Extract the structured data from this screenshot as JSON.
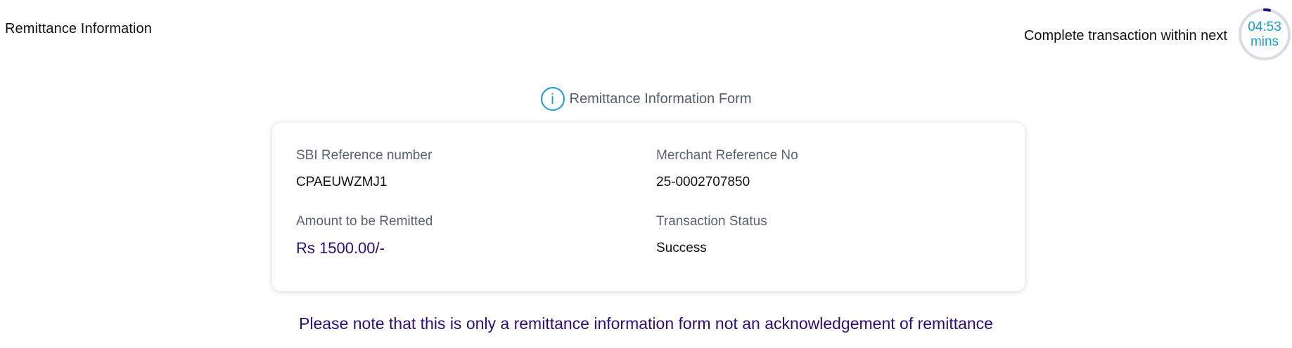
{
  "header": {
    "title": "Remittance Information",
    "timer_label": "Complete transaction within next",
    "timer_time": "04:53",
    "timer_unit": "mins",
    "timer_ring_color": "#1a9ad6",
    "timer_progress_color": "#2a0f7a"
  },
  "form": {
    "info_icon": "info-icon",
    "heading": "Remittance Information Form",
    "fields": [
      {
        "label": "SBI Reference number",
        "value": "CPAEUWZMJ1"
      },
      {
        "label": "Merchant Reference No",
        "value": "25-0002707850"
      },
      {
        "label": "Amount to be Remitted",
        "value": "Rs 1500.00/-"
      },
      {
        "label": "Transaction Status",
        "value": "Success"
      }
    ]
  },
  "note": "Please note that this is only a remittance information form not an acknowledgement of remittance",
  "colors": {
    "accent_blue": "#1a9ad6",
    "deep_purple": "#2a0f7a",
    "label_gray": "#5a6272"
  }
}
